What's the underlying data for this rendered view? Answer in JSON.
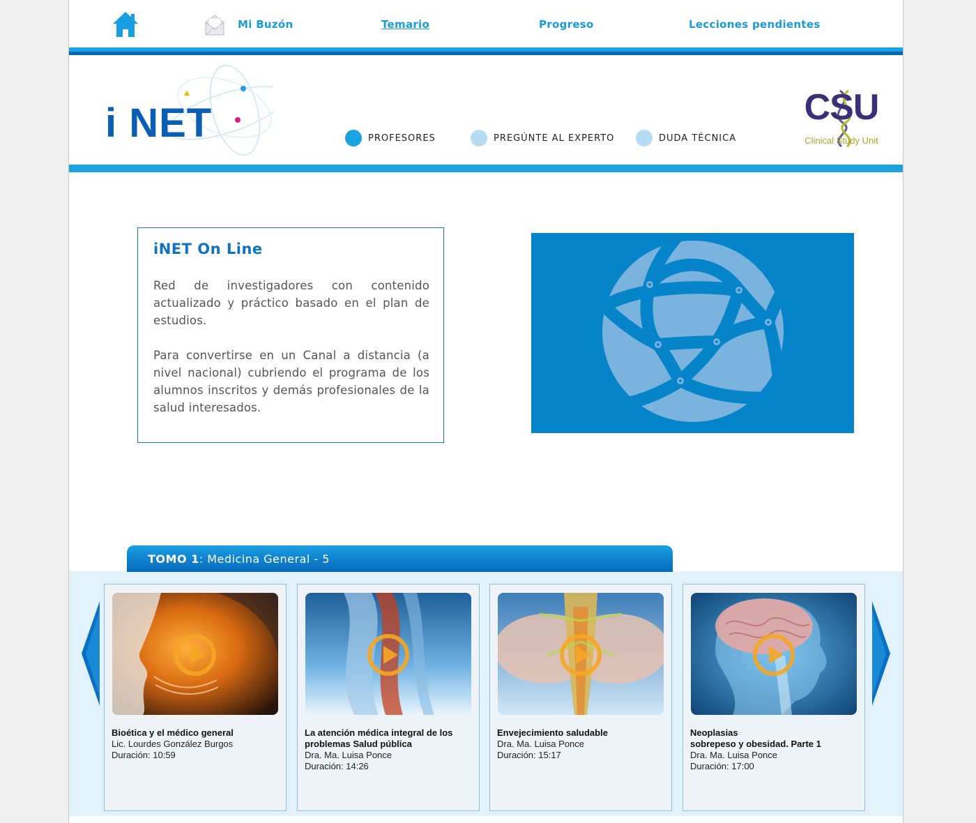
{
  "nav": {
    "links": [
      {
        "label": "Mi Buzón"
      },
      {
        "label": "Temario",
        "active": true
      },
      {
        "label": "Progreso"
      },
      {
        "label": "Lecciones pendientes"
      }
    ]
  },
  "header": {
    "logo_text": "i NET",
    "links": [
      {
        "label": "PROFESORES",
        "color": "#1aa3df"
      },
      {
        "label": "PREGÚNTE AL EXPERTO",
        "color": "#b5dcf4"
      },
      {
        "label": "DUDA TÉCNICA",
        "color": "#b5dcf4"
      }
    ],
    "partner_logo": {
      "letters": "CSU",
      "subtitle": "Clinical Study Unit"
    }
  },
  "intro": {
    "title": "iNET On Line",
    "paragraphs": [
      "Red de investigadores con contenido actualizado y práctico basado en el plan de estudios.",
      "Para convertirse en un  Canal a distancia (a nivel nacional) cubriendo el programa de los alumnos inscritos y demás profesionales de la salud interesados."
    ]
  },
  "course": {
    "tomo_bold": "TOMO 1",
    "tomo_rest": ": Medicina General - 5",
    "cards": [
      {
        "title": "Bioética y el médico general",
        "author": "Lic. Lourdes González Burgos",
        "duration": "Duración: 10:59"
      },
      {
        "title": "La atención médica integral de los problemas Salud pública",
        "author": "Dra.  Ma. Luisa Ponce",
        "duration": "Duración: 14:26"
      },
      {
        "title": "Envejecimiento saludable",
        "author": "Dra.  Ma. Luisa Ponce",
        "duration": "Duración: 15:17"
      },
      {
        "title": "Neoplasias\nsobrepeso y obesidad. Parte 1",
        "author": "Dra.  Ma. Luisa Ponce",
        "duration": "Duración: 17:00"
      }
    ]
  },
  "colors": {
    "accent": "#1aa3df",
    "dark_blue": "#0068b4",
    "play": "#f5a623"
  }
}
